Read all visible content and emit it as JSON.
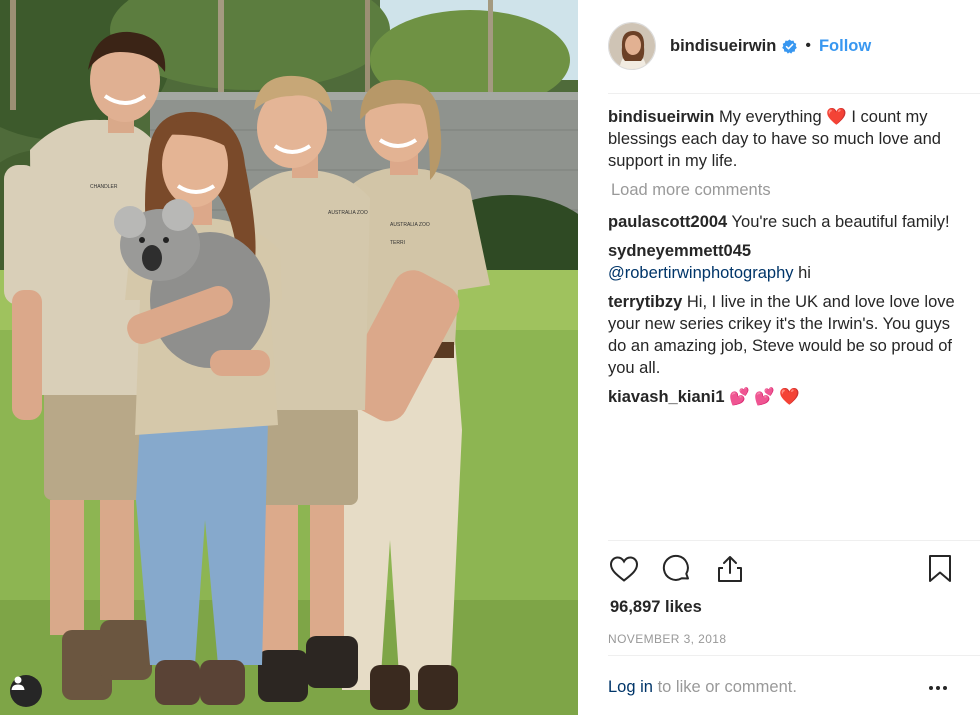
{
  "post": {
    "username": "bindisueirwin",
    "follow_label": "Follow",
    "dot": "•",
    "caption": "My everything ❤️ I count my blessings each day to have so much love and support in my life.",
    "load_more": "Load more comments",
    "comments": [
      {
        "user": "paulascott2004",
        "text": "You're such a beautiful family!"
      },
      {
        "user": "sydneyemmett045",
        "mention": "@robertirwinphotography",
        "text": "hi"
      },
      {
        "user": "terrytibzy",
        "text": "Hi, I live in the UK and love love love your new series crikey it's the Irwin's. You guys do an amazing job, Steve would be so proud of you all."
      },
      {
        "user": "kiavash_kiani1",
        "text": "💕 💕 ❤️"
      }
    ],
    "likes": "96,897 likes",
    "date": "NOVEMBER 3, 2018",
    "login_link": "Log in",
    "login_suffix": "to like or comment."
  },
  "shirt_badges": [
    "CHANDLER",
    "AUSTRALIA ZOO",
    "AUSTRALIA ZOO",
    "TERRI"
  ],
  "icons": {
    "verified": "verified-badge-icon",
    "like": "heart-icon",
    "comment": "comment-bubble-icon",
    "share": "share-upload-icon",
    "save": "bookmark-icon",
    "more": "ellipsis-icon",
    "tags": "user-tag-icon"
  },
  "colors": {
    "link": "#003569",
    "follow": "#3897f0",
    "muted": "#999999",
    "text": "#262626",
    "verified": "#3897f0"
  }
}
